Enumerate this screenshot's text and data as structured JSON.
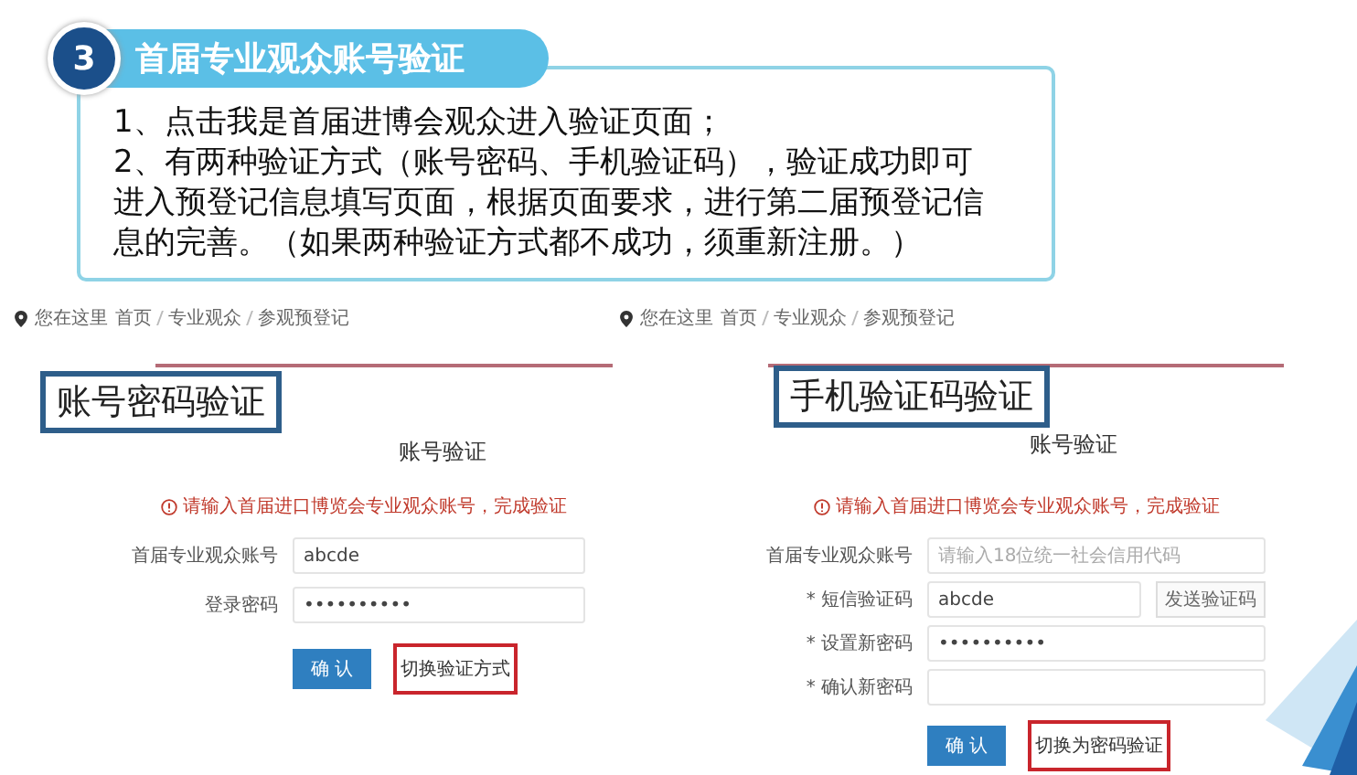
{
  "header": {
    "step": "3",
    "title": "首届专业观众账号验证"
  },
  "instructions": [
    "1、点击我是首届进博会观众进入验证页面；",
    "2、有两种验证方式（账号密码、手机验证码），验证成功即可进入预登记信息填写页面，根据页面要求，进行第二届预登记信息的完善。（如果两种验证方式都不成功，须重新注册。）"
  ],
  "screenshots": [
    {
      "breadcrumb": {
        "label": "您在这里",
        "items": [
          "首页",
          "专业观众",
          "参观预登记"
        ]
      },
      "callout": "账号密码验证",
      "title": "账号验证",
      "notice": "请输入首届进口博览会专业观众账号，完成验证",
      "fields": [
        {
          "label": "首届专业观众账号",
          "value": "abcde"
        },
        {
          "label": "登录密码",
          "value": "••••••••••"
        }
      ],
      "confirm": "确 认",
      "switch_link": "切换验证方式"
    },
    {
      "breadcrumb": {
        "label": "您在这里",
        "items": [
          "首页",
          "专业观众",
          "参观预登记"
        ]
      },
      "callout": "手机验证码验证",
      "title": "账号验证",
      "notice": "请输入首届进口博览会专业观众账号，完成验证",
      "fields": [
        {
          "label": "首届专业观众账号",
          "placeholder": "请输入18位统一社会信用代码"
        },
        {
          "label": "* 短信验证码",
          "value": "abcde",
          "button": "发送验证码"
        },
        {
          "label": "* 设置新密码",
          "value": "••••••••••"
        },
        {
          "label": "* 确认新密码"
        }
      ],
      "confirm": "确 认",
      "switch_link": "切换为密码验证"
    }
  ]
}
